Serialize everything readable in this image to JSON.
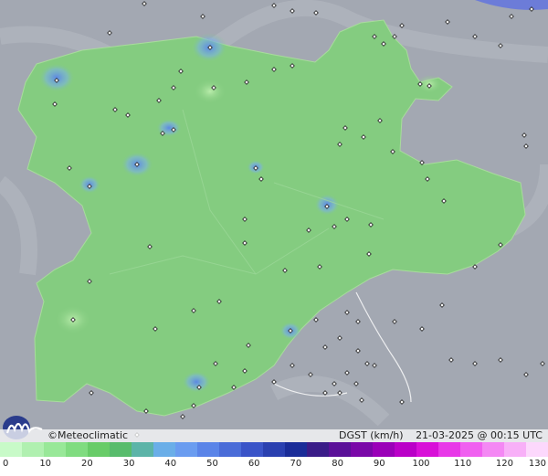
{
  "map": {
    "credit": "©Meteoclimatic",
    "variable": "DGST (km/h)",
    "timestamp": "21-03-2025 @ 00:15 UTC"
  },
  "scale": {
    "ticks": [
      "0",
      "10",
      "20",
      "30",
      "40",
      "50",
      "60",
      "70",
      "80",
      "90",
      "100",
      "110",
      "120",
      "130"
    ],
    "colors": [
      "#c8fac8",
      "#b0f0b0",
      "#98e898",
      "#80dc80",
      "#68cc68",
      "#58bc6c",
      "#5cb4a8",
      "#6aaee8",
      "#6a9cf0",
      "#5a84e8",
      "#4a6cd8",
      "#3a54c8",
      "#2a40b0",
      "#1a2c98",
      "#3a1c88",
      "#5a1098",
      "#7a08a8",
      "#9a00b8",
      "#ba00c8",
      "#d810d8",
      "#e838e8",
      "#f060f0",
      "#f488f4",
      "#f8b0f8",
      "#fcd8fc"
    ]
  },
  "colors": {
    "terrain": "#9aa0ab",
    "region": "#84cc80",
    "gust_high": "#6a9cf0"
  }
}
